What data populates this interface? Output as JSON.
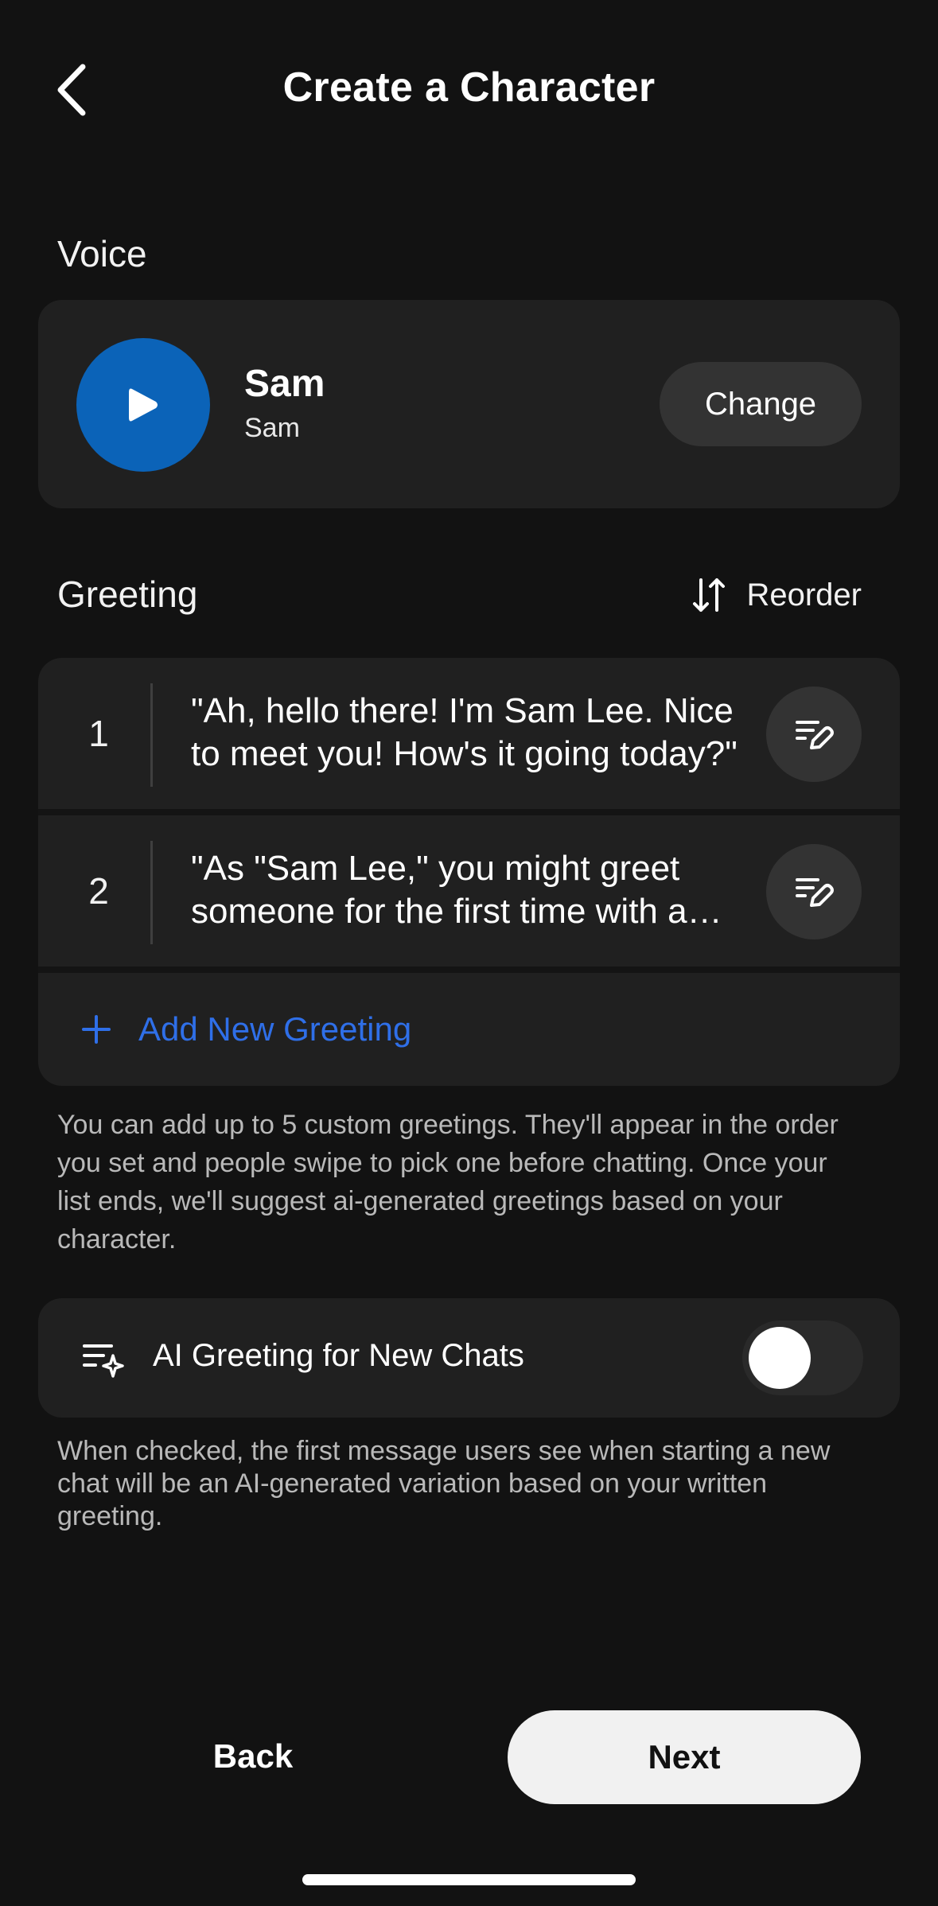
{
  "header": {
    "title": "Create a Character",
    "back_icon": "chevron-left-icon"
  },
  "voice": {
    "heading": "Voice",
    "name": "Sam",
    "subtitle": "Sam",
    "change_label": "Change",
    "play_icon": "play-icon",
    "play_color": "#0b63b8"
  },
  "greeting": {
    "heading": "Greeting",
    "reorder_label": "Reorder",
    "reorder_icon": "sort-arrows-icon",
    "items": [
      {
        "number": "1",
        "text": "\"Ah, hello there! I'm Sam Lee. Nice to meet you! How's it going today?\""
      },
      {
        "number": "2",
        "text": "\"As \"Sam Lee,\" you might greet someone for the first time with a friendly hello.\""
      }
    ],
    "add_label": "Add New Greeting",
    "add_color": "#2f6fe8",
    "help_text": "You can add up to 5 custom greetings. They'll appear in the order you set and people swipe to pick one before chatting. Once your list ends, we'll suggest ai-generated greetings based on your character."
  },
  "ai_greeting": {
    "label": "AI Greeting for New Chats",
    "enabled": false,
    "help_text": "When checked, the first message users see when starting a new chat will be an AI-generated variation based on your written greeting."
  },
  "footer": {
    "back_label": "Back",
    "next_label": "Next"
  }
}
